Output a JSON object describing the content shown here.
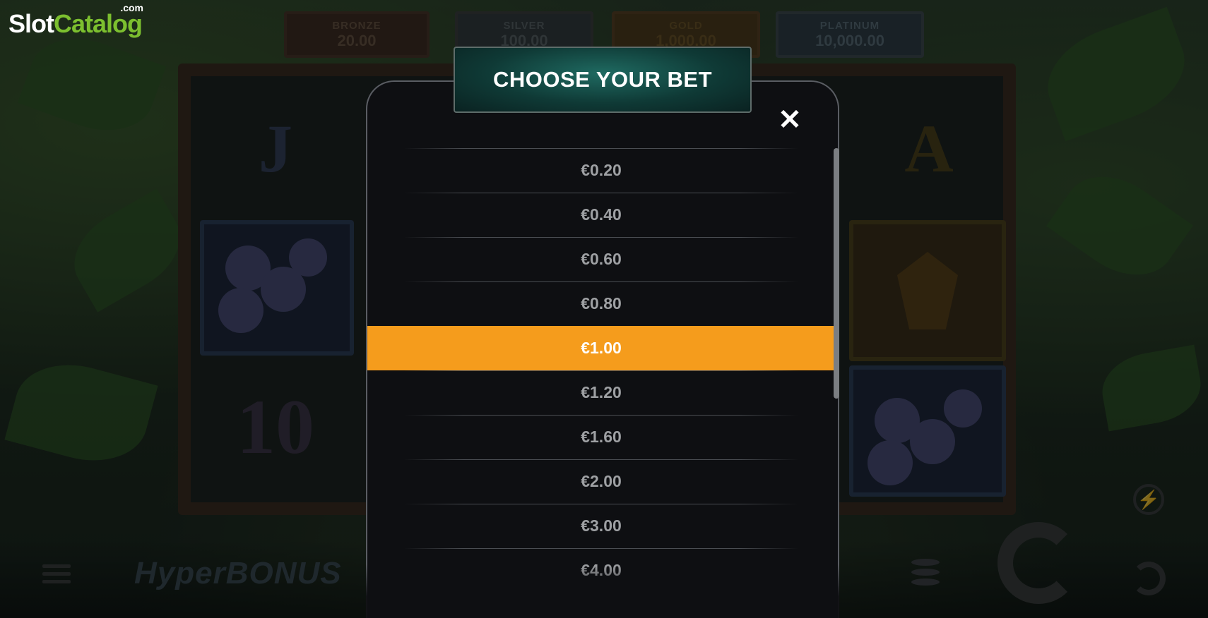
{
  "logo": {
    "slot": "Slot",
    "catalog": "Catalog",
    "dotcom": ".com"
  },
  "jackpots": [
    {
      "name": "BRONZE",
      "value": "20.00"
    },
    {
      "name": "SILVER",
      "value": "100.00"
    },
    {
      "name": "GOLD",
      "value": "1,000.00"
    },
    {
      "name": "PLATINUM",
      "value": "10,000.00"
    }
  ],
  "reels": {
    "sym_j": "J",
    "sym_a": "A",
    "sym_10": "10"
  },
  "bottom": {
    "brand": "HyperBONUS"
  },
  "modal": {
    "title": "CHOOSE YOUR BET",
    "close_icon": "close-icon",
    "selected_value": "€1.00",
    "bets": [
      "€0.20",
      "€0.40",
      "€0.60",
      "€0.80",
      "€1.00",
      "€1.20",
      "€1.60",
      "€2.00",
      "€3.00",
      "€4.00"
    ]
  },
  "colors": {
    "selected": "#f59c1c",
    "header": "#1f6a61",
    "logo_green": "#7cbf2f"
  }
}
